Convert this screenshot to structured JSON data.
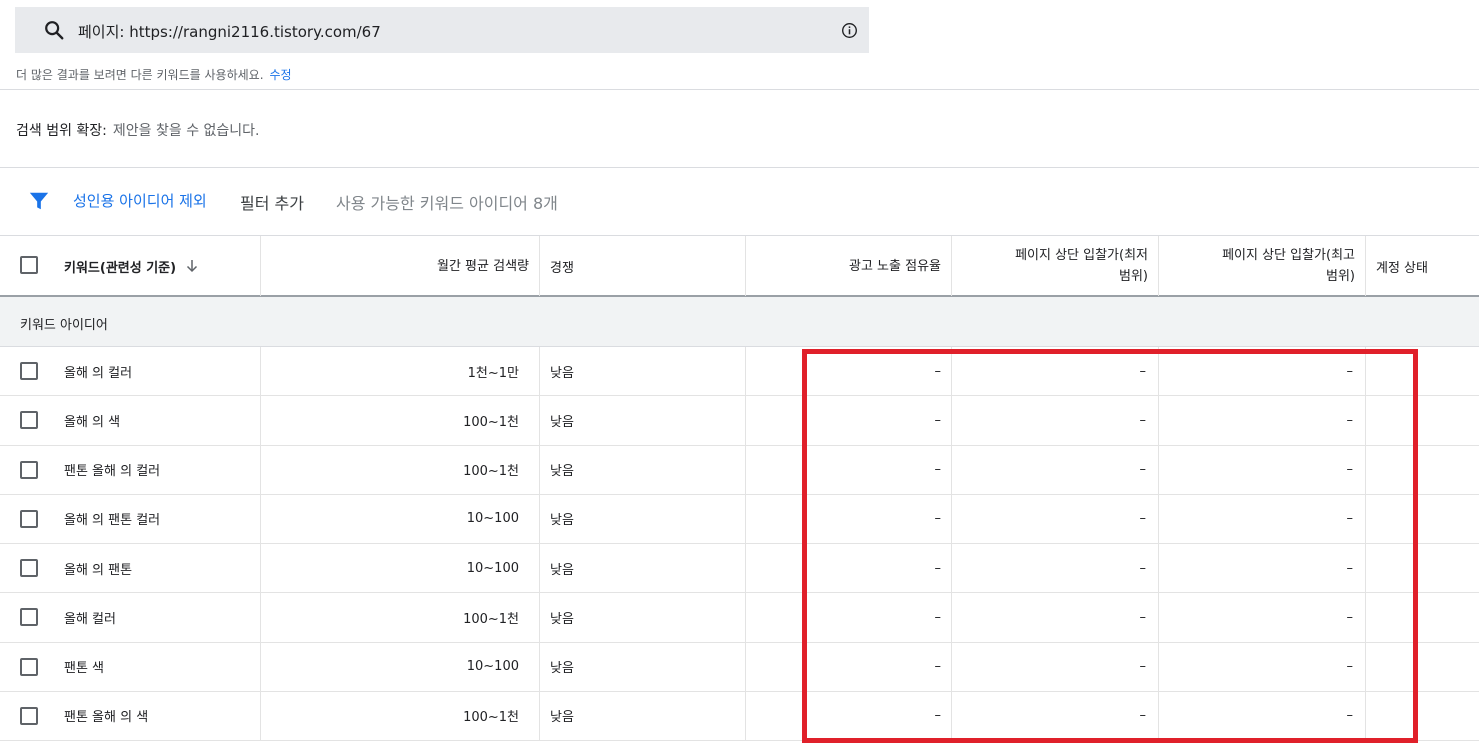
{
  "search": {
    "text": "페이지: https://rangni2116.tistory.com/67"
  },
  "hint": {
    "text": "더 많은 결과를 보려면 다른 키워드를 사용하세요.",
    "link": "수정"
  },
  "expand": {
    "label": "검색 범위 확장:",
    "value": "제안을 찾을 수 없습니다."
  },
  "filters": {
    "chip": "성인용 아이디어 제외",
    "add_filter": "필터 추가",
    "count": "사용 가능한 키워드 아이디어 8개"
  },
  "table": {
    "headers": {
      "keyword": "키워드(관련성 기준)",
      "monthly": "월간 평균 검색량",
      "competition": "경쟁",
      "impression_share": "광고 노출 점유율",
      "top_bid_low_1": "페이지 상단 입찰가(최저",
      "top_bid_low_2": "범위)",
      "top_bid_high_1": "페이지 상단 입찰가(최고",
      "top_bid_high_2": "범위)",
      "account_status": "계정 상태"
    },
    "group_label": "키워드 아이디어",
    "rows": [
      {
        "keyword": "올해 의 컬러",
        "monthly": "1천~1만",
        "competition": "낮음",
        "impression_share": "–",
        "bid_low": "–",
        "bid_high": "–"
      },
      {
        "keyword": "올해 의 색",
        "monthly": "100~1천",
        "competition": "낮음",
        "impression_share": "–",
        "bid_low": "–",
        "bid_high": "–"
      },
      {
        "keyword": "팬톤 올해 의 컬러",
        "monthly": "100~1천",
        "competition": "낮음",
        "impression_share": "–",
        "bid_low": "–",
        "bid_high": "–"
      },
      {
        "keyword": "올해 의 팬톤 컬러",
        "monthly": "10~100",
        "competition": "낮음",
        "impression_share": "–",
        "bid_low": "–",
        "bid_high": "–"
      },
      {
        "keyword": "올해 의 팬톤",
        "monthly": "10~100",
        "competition": "낮음",
        "impression_share": "–",
        "bid_low": "–",
        "bid_high": "–"
      },
      {
        "keyword": "올해 컬러",
        "monthly": "100~1천",
        "competition": "낮음",
        "impression_share": "–",
        "bid_low": "–",
        "bid_high": "–"
      },
      {
        "keyword": "팬톤 색",
        "monthly": "10~100",
        "competition": "낮음",
        "impression_share": "–",
        "bid_low": "–",
        "bid_high": "–"
      },
      {
        "keyword": "팬톤 올해 의 색",
        "monthly": "100~1천",
        "competition": "낮음",
        "impression_share": "–",
        "bid_low": "–",
        "bid_high": "–"
      }
    ]
  },
  "colors": {
    "accent": "#1a73e8",
    "highlight": "#e0202a",
    "search_bg": "#e8eaed",
    "group_bg": "#f1f3f4"
  },
  "icons": {
    "search": "search-icon",
    "info": "info-icon",
    "filter": "filter-icon",
    "sort": "arrow-down-icon"
  }
}
